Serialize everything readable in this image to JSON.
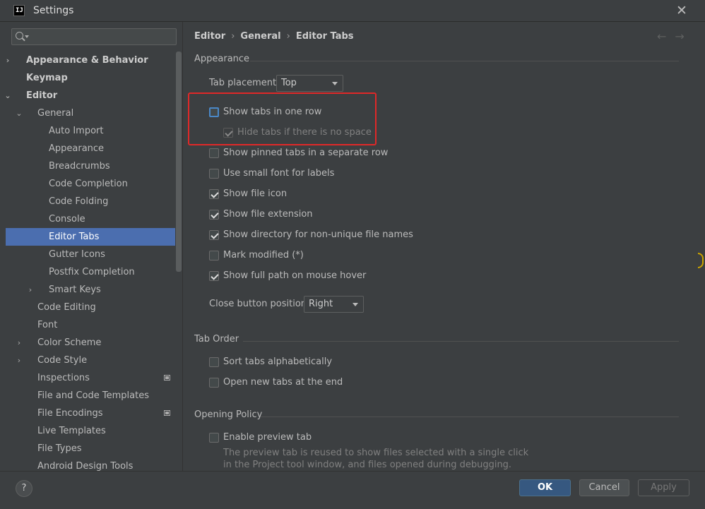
{
  "window": {
    "title": "Settings",
    "logo_text": "IJ",
    "close_glyph": "✕"
  },
  "search": {
    "placeholder": ""
  },
  "tree": [
    {
      "label": "Appearance & Behavior",
      "level": 0,
      "bold": true,
      "arrow": "›"
    },
    {
      "label": "Keymap",
      "level": 0,
      "bold": true,
      "arrow": ""
    },
    {
      "label": "Editor",
      "level": 0,
      "bold": true,
      "arrow": "⌄"
    },
    {
      "label": "General",
      "level": 1,
      "bold": false,
      "arrow": "⌄"
    },
    {
      "label": "Auto Import",
      "level": 2,
      "bold": false,
      "arrow": ""
    },
    {
      "label": "Appearance",
      "level": 2,
      "bold": false,
      "arrow": ""
    },
    {
      "label": "Breadcrumbs",
      "level": 2,
      "bold": false,
      "arrow": ""
    },
    {
      "label": "Code Completion",
      "level": 2,
      "bold": false,
      "arrow": ""
    },
    {
      "label": "Code Folding",
      "level": 2,
      "bold": false,
      "arrow": ""
    },
    {
      "label": "Console",
      "level": 2,
      "bold": false,
      "arrow": ""
    },
    {
      "label": "Editor Tabs",
      "level": 2,
      "bold": false,
      "arrow": "",
      "selected": true
    },
    {
      "label": "Gutter Icons",
      "level": 2,
      "bold": false,
      "arrow": ""
    },
    {
      "label": "Postfix Completion",
      "level": 2,
      "bold": false,
      "arrow": ""
    },
    {
      "label": "Smart Keys",
      "level": 2,
      "bold": false,
      "arrow": "›"
    },
    {
      "label": "Code Editing",
      "level": 1,
      "bold": false,
      "arrow": ""
    },
    {
      "label": "Font",
      "level": 1,
      "bold": false,
      "arrow": ""
    },
    {
      "label": "Color Scheme",
      "level": 1,
      "bold": false,
      "arrow": "›"
    },
    {
      "label": "Code Style",
      "level": 1,
      "bold": false,
      "arrow": "›"
    },
    {
      "label": "Inspections",
      "level": 1,
      "bold": false,
      "arrow": "",
      "badge": true
    },
    {
      "label": "File and Code Templates",
      "level": 1,
      "bold": false,
      "arrow": ""
    },
    {
      "label": "File Encodings",
      "level": 1,
      "bold": false,
      "arrow": "",
      "badge": true
    },
    {
      "label": "Live Templates",
      "level": 1,
      "bold": false,
      "arrow": ""
    },
    {
      "label": "File Types",
      "level": 1,
      "bold": false,
      "arrow": ""
    },
    {
      "label": "Android Design Tools",
      "level": 1,
      "bold": false,
      "arrow": ""
    }
  ],
  "breadcrumb": [
    "Editor",
    "General",
    "Editor Tabs"
  ],
  "nav": {
    "back": "←",
    "forward": "→"
  },
  "appearance": {
    "section_title": "Appearance",
    "tab_placement_label": "Tab placement:",
    "tab_placement_value": "Top",
    "options": [
      {
        "label": "Show tabs in one row",
        "checked": false,
        "focused": true
      },
      {
        "label": "Hide tabs if there is no space",
        "checked": true,
        "disabled": true,
        "indent": true
      },
      {
        "label": "Show pinned tabs in a separate row",
        "checked": false
      },
      {
        "label": "Use small font for labels",
        "checked": false
      },
      {
        "label": "Show file icon",
        "checked": true
      },
      {
        "label": "Show file extension",
        "checked": true
      },
      {
        "label": "Show directory for non-unique file names",
        "checked": true
      },
      {
        "label": "Mark modified (*)",
        "checked": false
      },
      {
        "label": "Show full path on mouse hover",
        "checked": true
      }
    ],
    "close_button_label": "Close button position:",
    "close_button_value": "Right"
  },
  "tab_order": {
    "section_title": "Tab Order",
    "options": [
      {
        "label": "Sort tabs alphabetically",
        "checked": false
      },
      {
        "label": "Open new tabs at the end",
        "checked": false
      }
    ]
  },
  "opening_policy": {
    "section_title": "Opening Policy",
    "options": [
      {
        "label": "Enable preview tab",
        "checked": false
      }
    ],
    "help_line1": "The preview tab is reused to show files selected with a single click",
    "help_line2": "in the Project tool window, and files opened during debugging."
  },
  "footer": {
    "help": "?",
    "ok": "OK",
    "cancel": "Cancel",
    "apply": "Apply"
  },
  "colors": {
    "accent": "#4b6eaf",
    "highlight_box": "#e02828",
    "ok_button": "#365880"
  }
}
